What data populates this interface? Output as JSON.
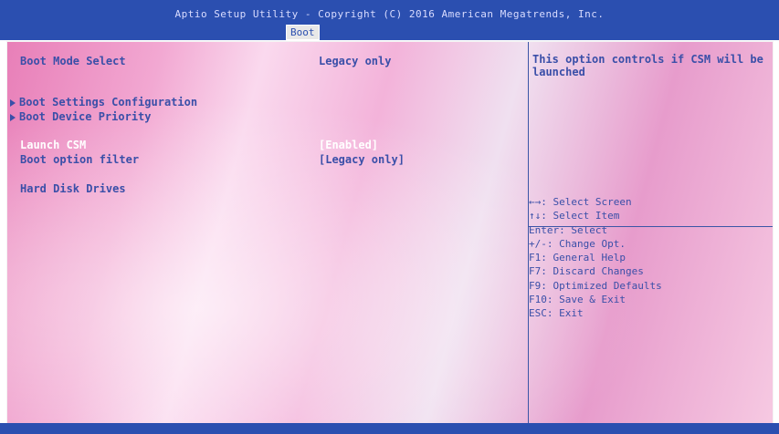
{
  "header": {
    "title": "Aptio Setup Utility - Copyright (C) 2016 American Megatrends, Inc.",
    "active_tab": "Boot"
  },
  "settings": {
    "boot_mode_select": {
      "label": "Boot Mode Select",
      "value": "Legacy only"
    },
    "boot_settings_configuration": {
      "label": "Boot Settings Configuration"
    },
    "boot_device_priority": {
      "label": "Boot Device Priority"
    },
    "launch_csm": {
      "label": "Launch CSM",
      "value": "[Enabled]"
    },
    "boot_option_filter": {
      "label": "Boot option filter",
      "value": "[Legacy only]"
    },
    "hard_disk_drives": {
      "label": "Hard Disk Drives"
    }
  },
  "help": {
    "description": "This option controls if CSM will be launched"
  },
  "keys": [
    "←→: Select Screen",
    "↑↓: Select Item",
    "Enter: Select",
    "+/-: Change Opt.",
    "F1: General Help",
    "F7: Discard Changes",
    "F9: Optimized Defaults",
    "F10: Save & Exit",
    "ESC: Exit"
  ],
  "colors": {
    "header_bg": "#2b4fb0",
    "text": "#3a4fa8",
    "selected_text": "#ffffff",
    "panel_bg": "#f2a8d2"
  }
}
